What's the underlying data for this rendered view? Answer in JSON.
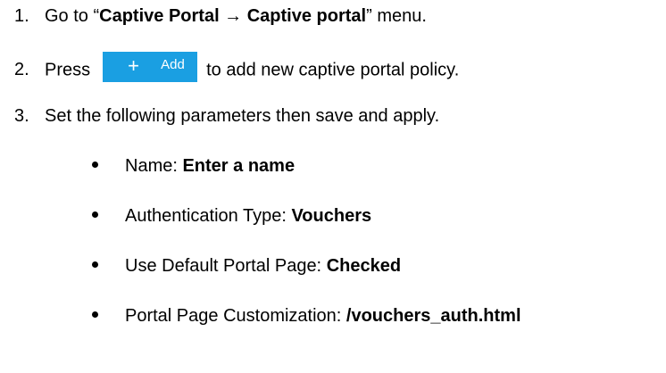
{
  "steps": [
    {
      "number": "1.",
      "prefix": "Go to “",
      "bold": "Captive Portal → Captive portal",
      "suffix": "” menu."
    },
    {
      "number": "2.",
      "prefix": "Press",
      "button": {
        "icon": "plus-icon",
        "plus_glyph": "+",
        "label": "Add",
        "color": "#1a9fe2"
      },
      "suffix": "to add new captive portal policy."
    },
    {
      "number": "3.",
      "text": "Set the following parameters then save and apply."
    }
  ],
  "parameters": [
    {
      "name": "Name: ",
      "value": "Enter a name"
    },
    {
      "name": "Authentication Type: ",
      "value": "Vouchers"
    },
    {
      "name": "Use Default Portal Page: ",
      "value": "Checked"
    },
    {
      "name": "Portal Page Customization: ",
      "value": "/vouchers_auth.html"
    }
  ]
}
